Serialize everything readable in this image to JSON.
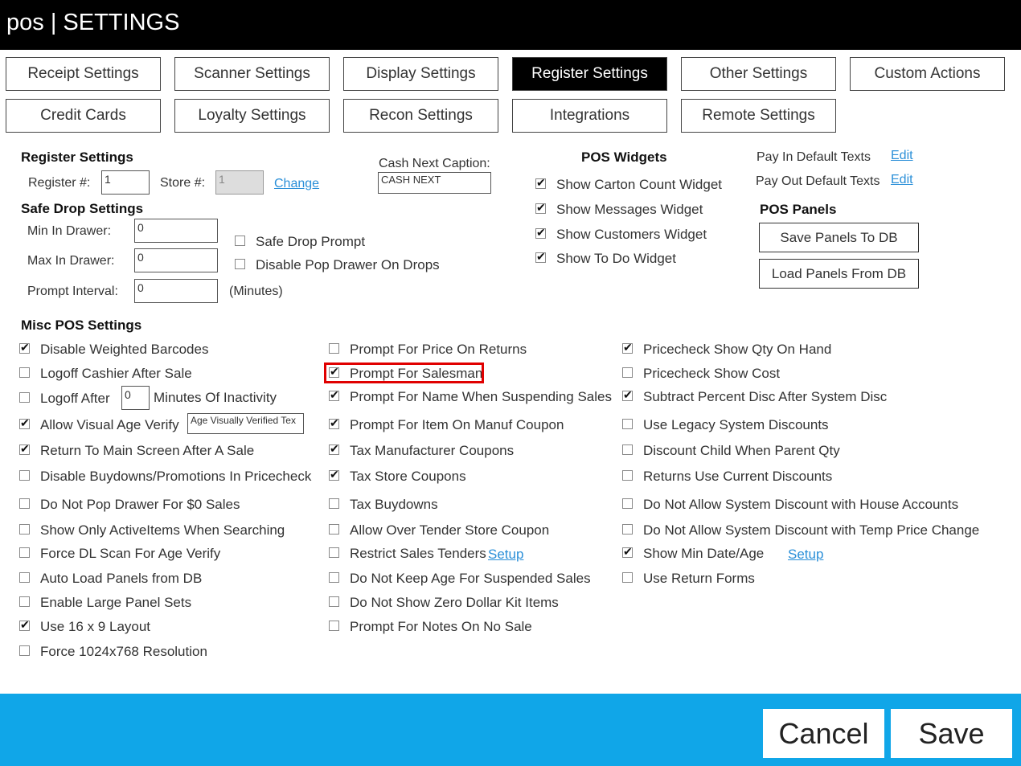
{
  "window": {
    "title": "pos | SETTINGS"
  },
  "tabs": [
    {
      "label": "Receipt Settings"
    },
    {
      "label": "Scanner Settings"
    },
    {
      "label": "Display Settings"
    },
    {
      "label": "Register Settings"
    },
    {
      "label": "Other Settings"
    },
    {
      "label": "Custom Actions"
    },
    {
      "label": "Credit Cards"
    },
    {
      "label": "Loyalty Settings"
    },
    {
      "label": "Recon Settings"
    },
    {
      "label": "Integrations"
    },
    {
      "label": "Remote Settings"
    }
  ],
  "active_tab": "Register Settings",
  "register": {
    "heading": "Register Settings",
    "register_label": "Register #:",
    "register_value": "1",
    "store_label": "Store #:",
    "store_value": "1",
    "change_link": "Change"
  },
  "cash_next": {
    "label": "Cash Next Caption:",
    "value": "CASH NEXT"
  },
  "safe_drop": {
    "heading": "Safe Drop Settings",
    "min_label": "Min In Drawer:",
    "min_value": "0",
    "max_label": "Max In Drawer:",
    "max_value": "0",
    "interval_label": "Prompt Interval:",
    "interval_value": "0",
    "minutes_label": "(Minutes)",
    "safe_drop_prompt": {
      "label": "Safe Drop Prompt",
      "checked": false
    },
    "disable_pop_drawer": {
      "label": "Disable Pop Drawer On Drops",
      "checked": false
    }
  },
  "pos_widgets": {
    "heading": "POS Widgets",
    "items": [
      {
        "label": "Show Carton Count Widget",
        "checked": true
      },
      {
        "label": "Show Messages Widget",
        "checked": true
      },
      {
        "label": "Show Customers Widget",
        "checked": true
      },
      {
        "label": "Show To Do Widget",
        "checked": true
      }
    ]
  },
  "pay_texts": {
    "pay_in_label": "Pay In Default Texts",
    "pay_out_label": "Pay Out Default Texts",
    "edit_label": "Edit"
  },
  "pos_panels": {
    "heading": "POS Panels",
    "save_label": "Save Panels To DB",
    "load_label": "Load Panels From DB"
  },
  "misc": {
    "heading": "Misc POS Settings",
    "col1": [
      {
        "label": "Disable Weighted Barcodes",
        "checked": true
      },
      {
        "label": "Logoff Cashier After Sale",
        "checked": false
      },
      {
        "label": "Logoff After",
        "checked": false
      },
      {
        "label": "Allow Visual Age Verify",
        "checked": true
      },
      {
        "label": "Return To Main Screen After A Sale",
        "checked": true
      },
      {
        "label": "Disable Buydowns/Promotions In Pricecheck",
        "checked": false
      },
      {
        "label": "Do Not Pop Drawer For $0 Sales",
        "checked": false
      },
      {
        "label": "Show Only ActiveItems When Searching",
        "checked": false
      },
      {
        "label": "Force DL Scan For Age Verify",
        "checked": false
      },
      {
        "label": "Auto Load Panels from DB",
        "checked": false
      },
      {
        "label": "Enable Large Panel Sets",
        "checked": false
      },
      {
        "label": "Use 16 x 9 Layout",
        "checked": true
      },
      {
        "label": "Force 1024x768 Resolution",
        "checked": false
      }
    ],
    "logoff_minutes_value": "0",
    "logoff_minutes_label": "Minutes Of Inactivity",
    "age_verify_text": "Age Visually Verified Tex",
    "col2": [
      {
        "label": "Prompt For Price On Returns",
        "checked": false
      },
      {
        "label": "Prompt For Salesman",
        "checked": true
      },
      {
        "label": "Prompt For Name When Suspending Sales",
        "checked": true
      },
      {
        "label": "Prompt For Item On Manuf Coupon",
        "checked": true
      },
      {
        "label": "Tax Manufacturer Coupons",
        "checked": true
      },
      {
        "label": "Tax Store Coupons",
        "checked": true
      },
      {
        "label": "Tax Buydowns",
        "checked": false
      },
      {
        "label": "Allow Over Tender Store Coupon",
        "checked": false
      },
      {
        "label": "Restrict Sales Tenders",
        "checked": false
      },
      {
        "label": "Do Not Keep Age For Suspended Sales",
        "checked": false
      },
      {
        "label": "Do Not Show Zero Dollar Kit Items",
        "checked": false
      },
      {
        "label": "Prompt For Notes On No Sale",
        "checked": false
      }
    ],
    "col3": [
      {
        "label": "Pricecheck Show Qty On Hand",
        "checked": true
      },
      {
        "label": "Pricecheck Show Cost",
        "checked": false
      },
      {
        "label": "Subtract Percent Disc After System Disc",
        "checked": true
      },
      {
        "label": "Use Legacy System Discounts",
        "checked": false
      },
      {
        "label": "Discount Child When Parent Qty",
        "checked": false
      },
      {
        "label": "Returns Use Current Discounts",
        "checked": false
      },
      {
        "label": "Do Not Allow System Discount with House Accounts",
        "checked": false
      },
      {
        "label": "Do Not Allow System Discount with Temp Price Change",
        "checked": false
      },
      {
        "label": "Show Min Date/Age",
        "checked": true
      },
      {
        "label": "Use Return Forms",
        "checked": false
      }
    ],
    "setup_label": "Setup"
  },
  "footer": {
    "cancel_label": "Cancel",
    "save_label": "Save",
    "background": "#10a6e8"
  }
}
